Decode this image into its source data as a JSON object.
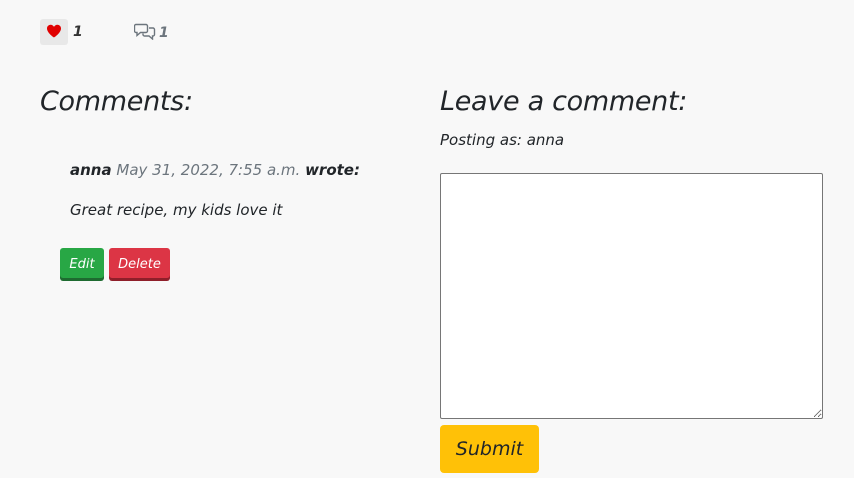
{
  "stats": {
    "like_count": "1",
    "comment_count": "1",
    "like_icon": "heart-icon",
    "comment_icon": "comments-icon",
    "like_color": "#e00000"
  },
  "comments_section": {
    "title": "Comments:",
    "comments": [
      {
        "author": "anna",
        "date": "May 31, 2022, 7:55 a.m.",
        "wrote_label": "wrote:",
        "body": "Great recipe, my kids love it",
        "edit_label": "Edit",
        "delete_label": "Delete"
      }
    ]
  },
  "comment_form": {
    "title": "Leave a comment:",
    "posting_as": "Posting as: anna",
    "textarea_value": "",
    "submit_label": "Submit"
  },
  "colors": {
    "background": "#f8f8f8",
    "edit_button": "#28a745",
    "delete_button": "#dc3545",
    "submit_button": "#ffc107"
  }
}
